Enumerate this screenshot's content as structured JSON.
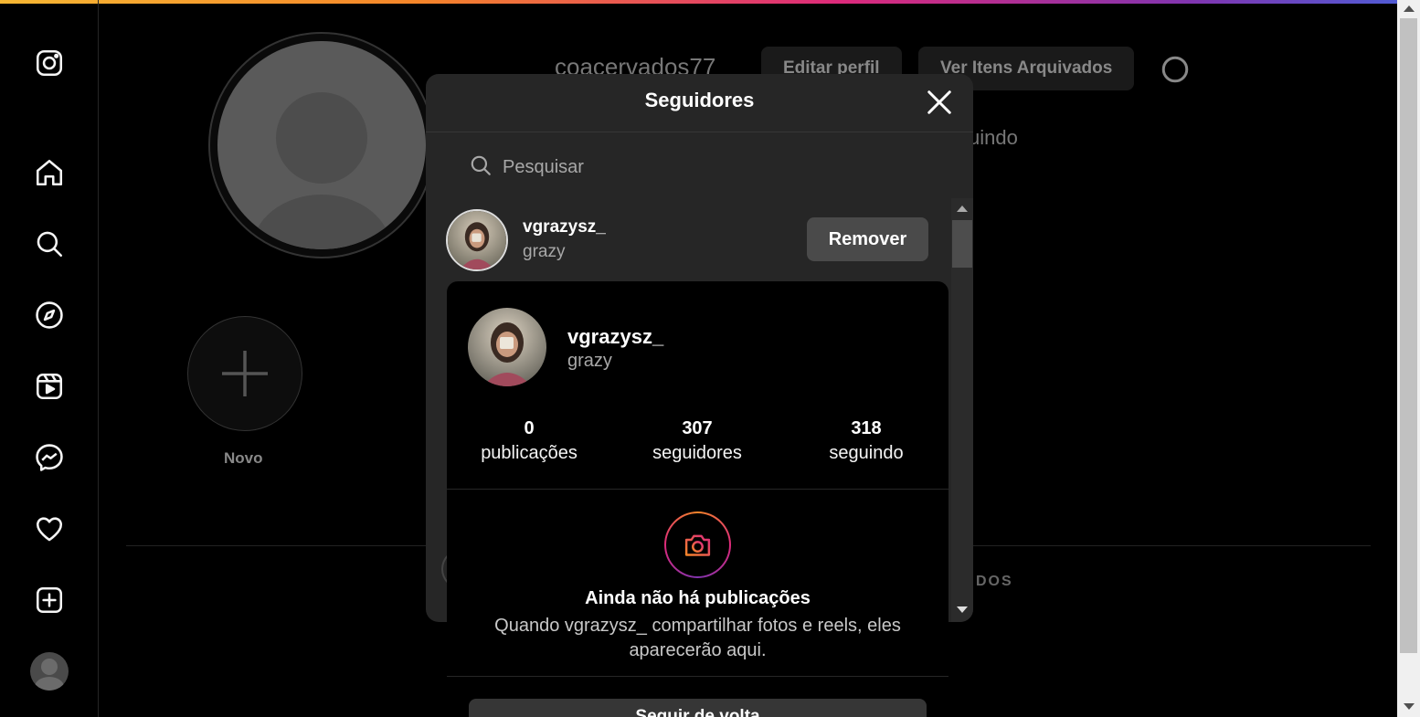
{
  "background_profile": {
    "username": "coacervados77",
    "edit_profile_label": "Editar perfil",
    "archived_label": "Ver Itens Arquivados",
    "following_fragment": "uindo",
    "new_highlight_label": "Novo",
    "saved_tab_fragment": "DOS"
  },
  "sidebar": {
    "items": [
      "instagram-logo",
      "home-icon",
      "search-icon",
      "explore-icon",
      "reels-icon",
      "messenger-icon",
      "heart-icon",
      "create-icon",
      "profile-avatar"
    ]
  },
  "followers_modal": {
    "title": "Seguidores",
    "search_placeholder": "Pesquisar",
    "rows": [
      {
        "username": "vgrazysz_",
        "full_name": "grazy",
        "action_label": "Remover"
      }
    ]
  },
  "hover_card": {
    "username": "vgrazysz_",
    "full_name": "grazy",
    "stats": [
      {
        "value": "0",
        "label": "publicações"
      },
      {
        "value": "307",
        "label": "seguidores"
      },
      {
        "value": "318",
        "label": "seguindo"
      }
    ],
    "empty_title": "Ainda não há publicações",
    "empty_text": "Quando vgrazysz_ compartilhar fotos e reels, eles aparecerão aqui.",
    "follow_label": "Seguir de volta"
  },
  "colors": {
    "accent_gradient": [
      "#f58529",
      "#dd2a7b",
      "#8134af"
    ],
    "modal_bg": "#262626",
    "card_bg": "#000000"
  }
}
